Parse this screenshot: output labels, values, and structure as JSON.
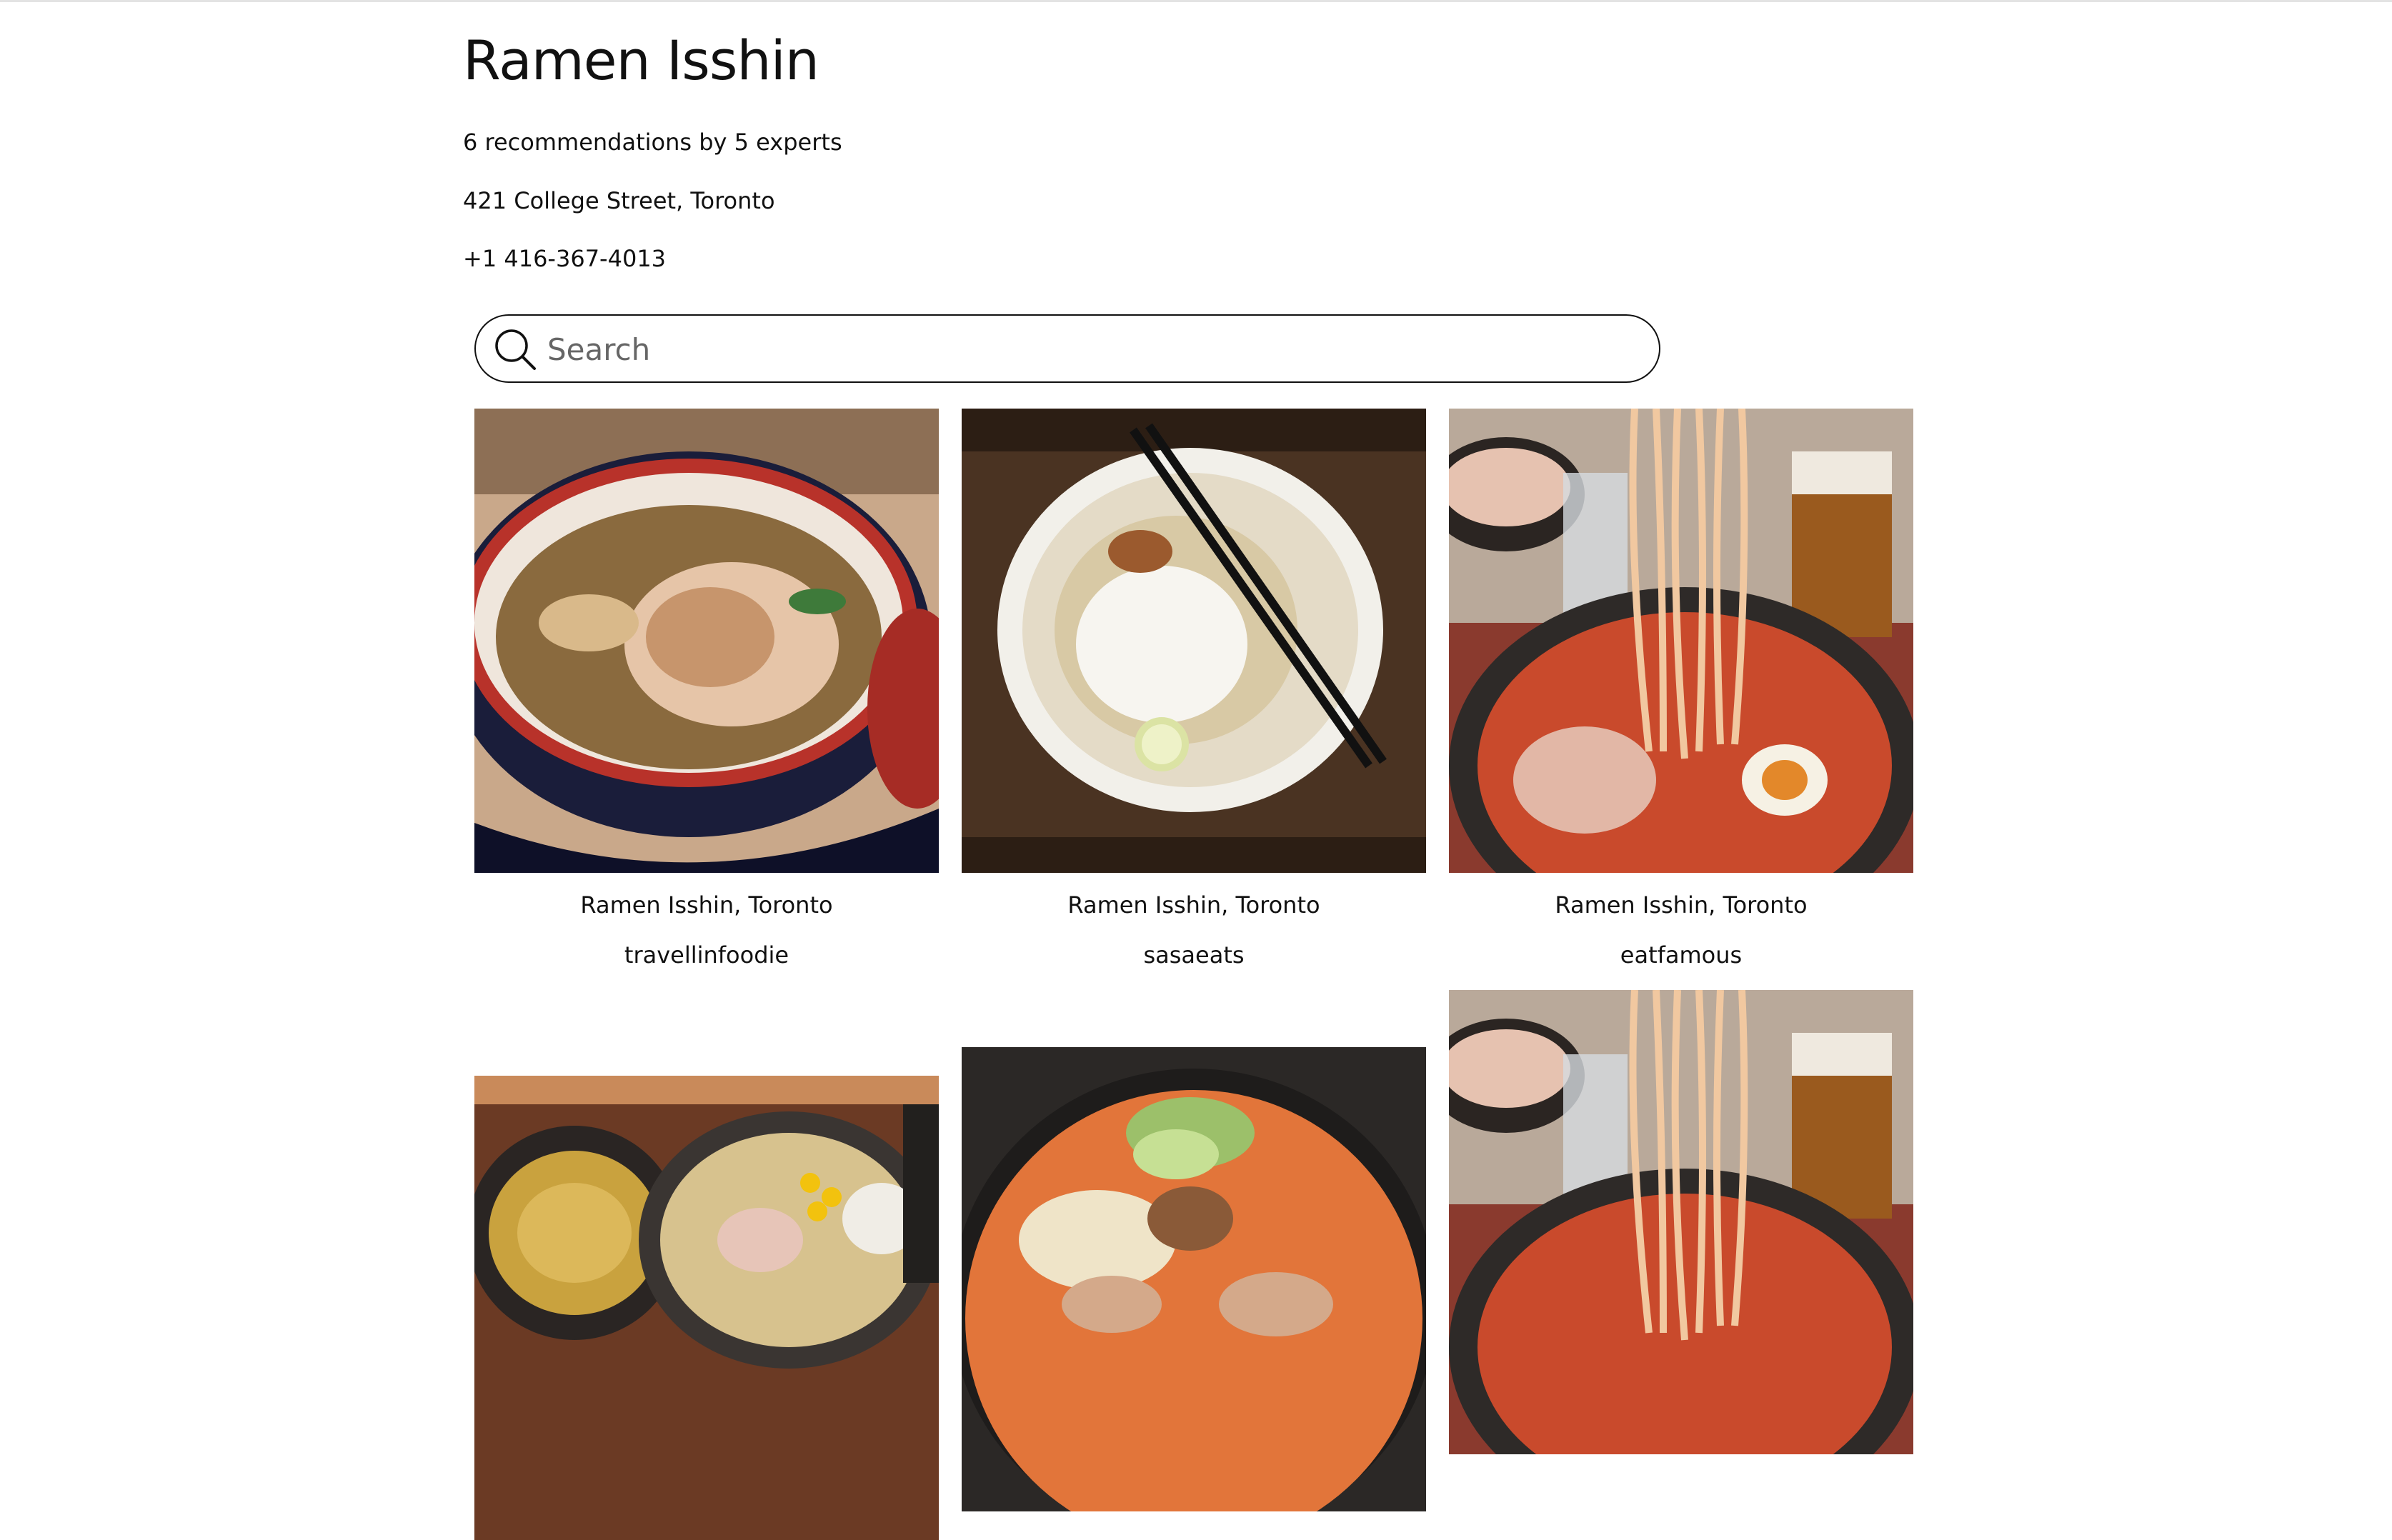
{
  "restaurant": {
    "name": "Ramen Isshin",
    "recommendations": "6 recommendations by 5 experts",
    "address": "421 College Street, Toronto",
    "phone": "+1 416-367-4013"
  },
  "search": {
    "placeholder": "Search"
  },
  "posts": [
    {
      "location": "Ramen Isshin, Toronto",
      "author": "travellinfoodie"
    },
    {
      "location": "Ramen Isshin, Toronto",
      "author": "sasaeats"
    },
    {
      "location": "Ramen Isshin, Toronto",
      "author": "eatfamous"
    },
    {
      "location": "",
      "author": ""
    },
    {
      "location": "",
      "author": ""
    },
    {
      "location": "",
      "author": ""
    }
  ],
  "icons": {
    "search": "search-icon"
  },
  "colors": {
    "text": "#111111",
    "border": "#111111",
    "background": "#ffffff"
  }
}
